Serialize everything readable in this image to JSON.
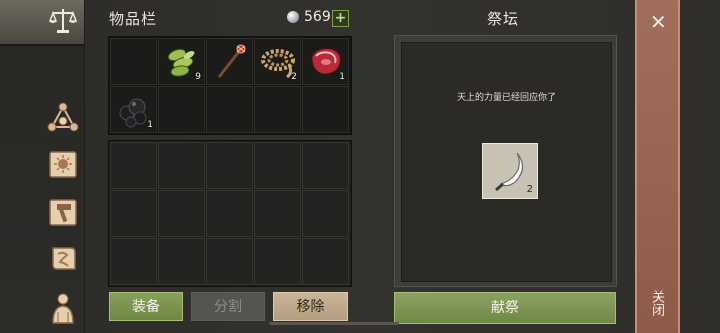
{
  "inventory": {
    "title": "物品栏",
    "currency": {
      "icon": "silver-gem-icon",
      "count": "569",
      "add_label": "+"
    },
    "slots": [
      {
        "icon": "",
        "qty": ""
      },
      {
        "icon": "green-bean-icon",
        "qty": "9"
      },
      {
        "icon": "magic-staff-icon",
        "qty": ""
      },
      {
        "icon": "rope-coil-icon",
        "qty": "2"
      },
      {
        "icon": "raw-meat-icon",
        "qty": "1"
      },
      {
        "icon": "coal-icon",
        "qty": "1"
      }
    ],
    "buttons": {
      "equip": "装备",
      "split": "分割",
      "remove": "移除"
    }
  },
  "altar": {
    "title": "祭坛",
    "message": "天上的力量已经回应你了",
    "slot": {
      "icon": "sickle-icon",
      "qty": "2"
    },
    "offer_button": "献祭"
  },
  "close": {
    "icon": "close-icon",
    "label": "关闭"
  },
  "sidebar": {
    "icons": [
      "scales-icon",
      "triangle-nodes-icon",
      "sun-book-icon",
      "hammer-map-icon",
      "scroll-icon",
      "character-icon"
    ]
  },
  "colors": {
    "accent_green": "#7b9550",
    "close_red": "#9a6455",
    "tan": "#c2ad8c"
  }
}
